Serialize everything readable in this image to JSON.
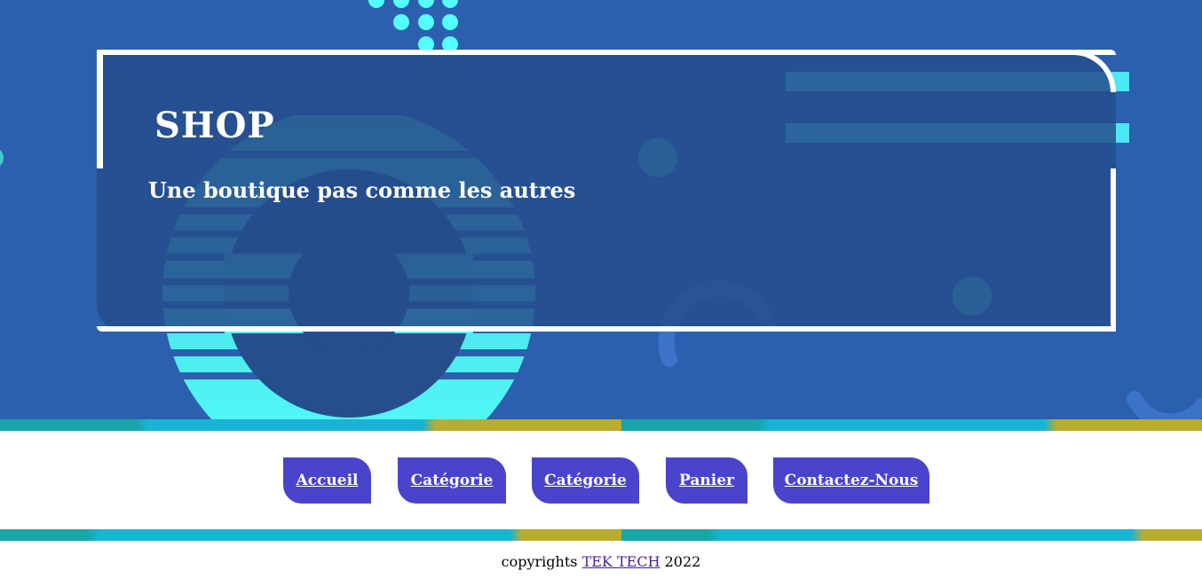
{
  "hero": {
    "title": "SHOP",
    "subtitle": "Une boutique pas comme les autres"
  },
  "nav": {
    "items": [
      {
        "label": "Accueil"
      },
      {
        "label": "Catégorie"
      },
      {
        "label": "Catégorie"
      },
      {
        "label": "Panier"
      },
      {
        "label": "Contactez-Nous"
      }
    ]
  },
  "footer": {
    "prefix": "copyrights",
    "link": "TEK TECH",
    "year": "2022"
  },
  "colors": {
    "hero_bg": "#2d5faf",
    "panel_bg": "#264e8c",
    "accent_cyan": "#53ffff",
    "button_bg": "#4a43cc",
    "stripe_teal": "#18a5a8",
    "stripe_blue": "#17b4d6",
    "stripe_olive": "#b8ad2e"
  }
}
